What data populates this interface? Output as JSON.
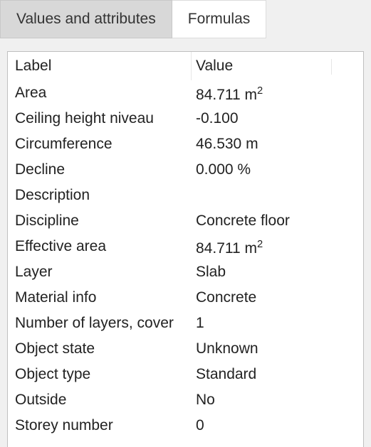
{
  "tabs": {
    "values_attributes": "Values and attributes",
    "formulas": "Formulas"
  },
  "headers": {
    "label": "Label",
    "value": "Value"
  },
  "rows": [
    {
      "label": "Area",
      "value": "84.711 m²"
    },
    {
      "label": "Ceiling height niveau",
      "value": "-0.100"
    },
    {
      "label": "Circumference",
      "value": "46.530 m"
    },
    {
      "label": "Decline",
      "value": "0.000 %"
    },
    {
      "label": "Description",
      "value": ""
    },
    {
      "label": "Discipline",
      "value": "Concrete floor"
    },
    {
      "label": "Effective area",
      "value": "84.711 m²"
    },
    {
      "label": "Layer",
      "value": "Slab"
    },
    {
      "label": "Material info",
      "value": "Concrete"
    },
    {
      "label": "Number of layers, cover",
      "value": "1"
    },
    {
      "label": "Object state",
      "value": "Unknown"
    },
    {
      "label": "Object type",
      "value": "Standard"
    },
    {
      "label": "Outside",
      "value": "No"
    },
    {
      "label": "Storey number",
      "value": "0"
    }
  ]
}
